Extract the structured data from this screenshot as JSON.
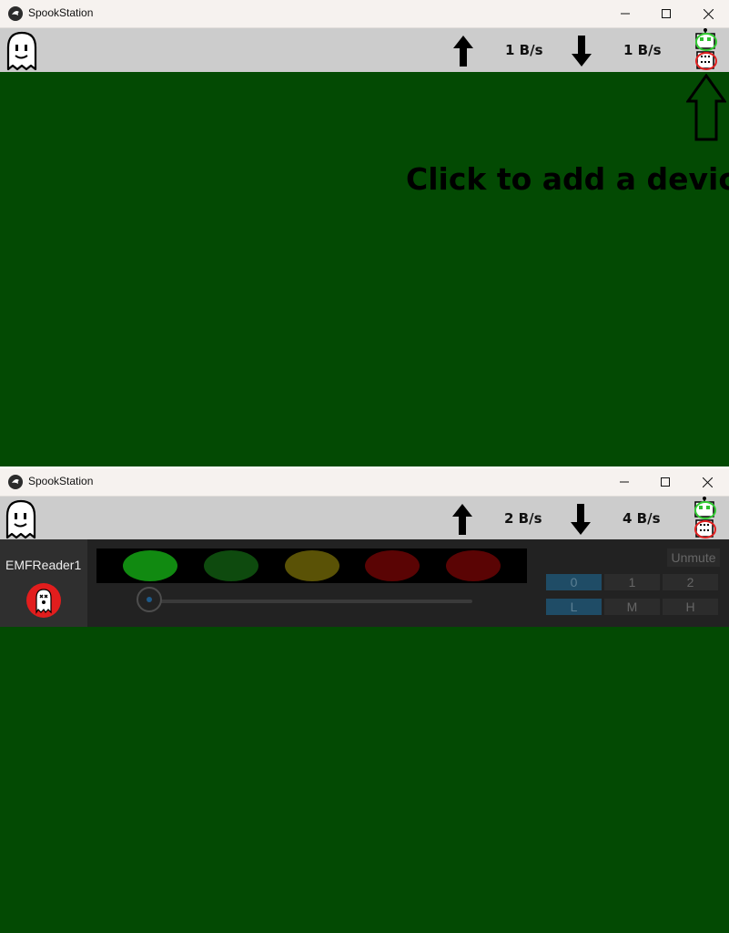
{
  "window1": {
    "title": "SpookStation",
    "toolbar": {
      "upload_rate": "1 B/s",
      "download_rate": "1 B/s"
    },
    "hint": "Click to add a device"
  },
  "window2": {
    "title": "SpookStation",
    "toolbar": {
      "upload_rate": "2 B/s",
      "download_rate": "4 B/s"
    },
    "device": {
      "name": "EMFReader1",
      "leds": [
        {
          "color": "#118a11"
        },
        {
          "color": "#0e4a0e"
        },
        {
          "color": "#5a5206"
        },
        {
          "color": "#5a0404"
        },
        {
          "color": "#5a0404"
        }
      ],
      "mute_label": "Unmute",
      "channel_options": [
        "0",
        "1",
        "2"
      ],
      "channel_selected": "0",
      "level_options": [
        "L",
        "M",
        "H"
      ],
      "level_selected": "L"
    }
  },
  "colors": {
    "content_bg": "#034a03",
    "toolbar_bg": "#cccccc",
    "device_bg": "#222222",
    "segment_active": "#1f4c66"
  },
  "icons": {
    "app": "kivy-icon",
    "ghost": "ghost-icon",
    "upload": "up-arrow-icon",
    "download": "down-arrow-icon",
    "robot": "robot-connect-icon"
  }
}
